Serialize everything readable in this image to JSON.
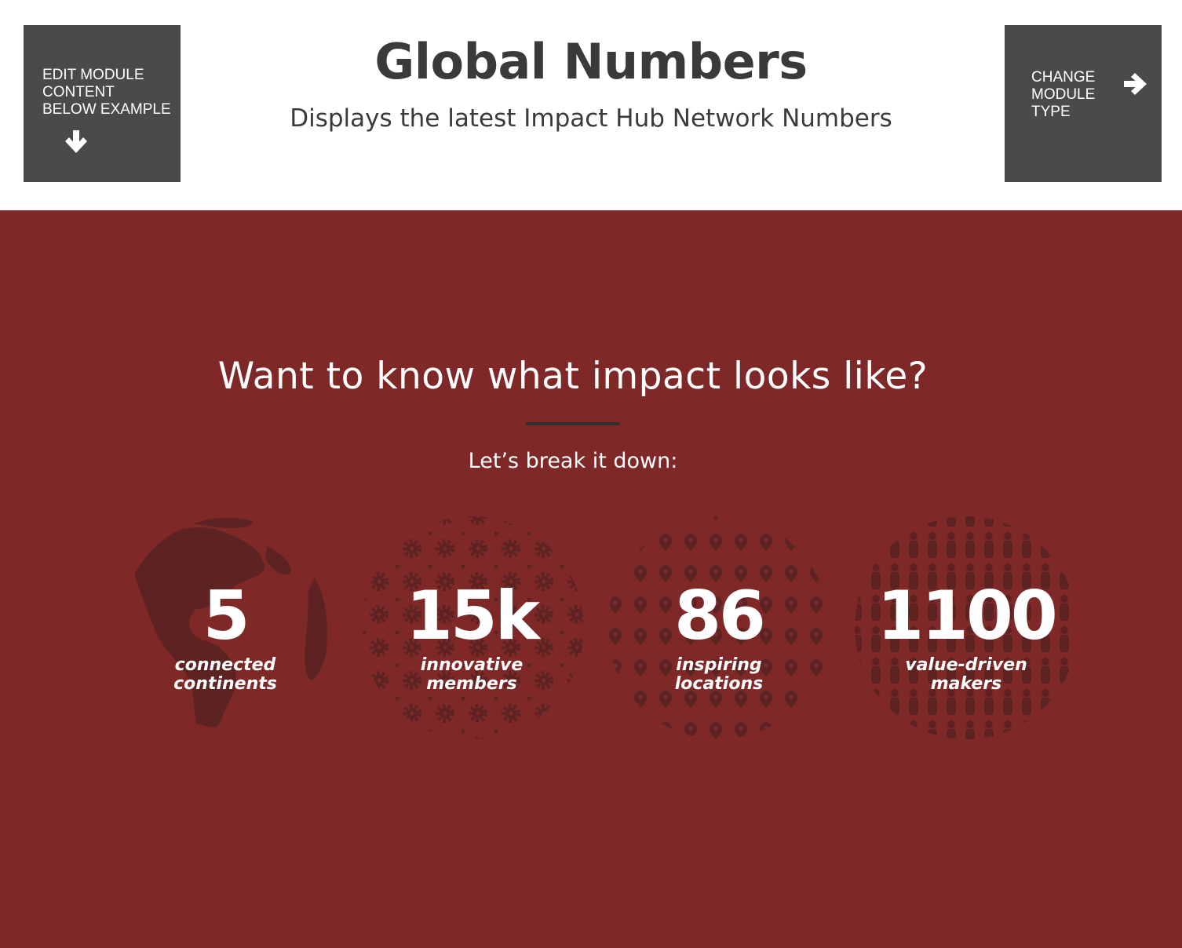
{
  "header": {
    "edit_button_label": "EDIT MODULE\nCONTENT\nBELOW EXAMPLE",
    "change_button_label": "CHANGE\nMODULE\nTYPE",
    "title": "Global Numbers",
    "subtitle": "Displays the latest Impact Hub Network Numbers",
    "edit_icon": "arrow-down-icon",
    "change_icon": "arrow-right-icon"
  },
  "banner": {
    "heading": "Want to know what impact looks like?",
    "subheading": "Let’s break it down:",
    "background_color": "#7f2828",
    "stats": [
      {
        "value": "5",
        "caption": "connected\ncontinents",
        "icon": "globe-icon"
      },
      {
        "value": "15k",
        "caption": "innovative\nmembers",
        "icon": "gears-pattern-icon"
      },
      {
        "value": "86",
        "caption": "inspiring\nlocations",
        "icon": "map-pins-pattern-icon"
      },
      {
        "value": "1100",
        "caption": "value-driven\nmakers",
        "icon": "people-pattern-icon"
      }
    ]
  }
}
